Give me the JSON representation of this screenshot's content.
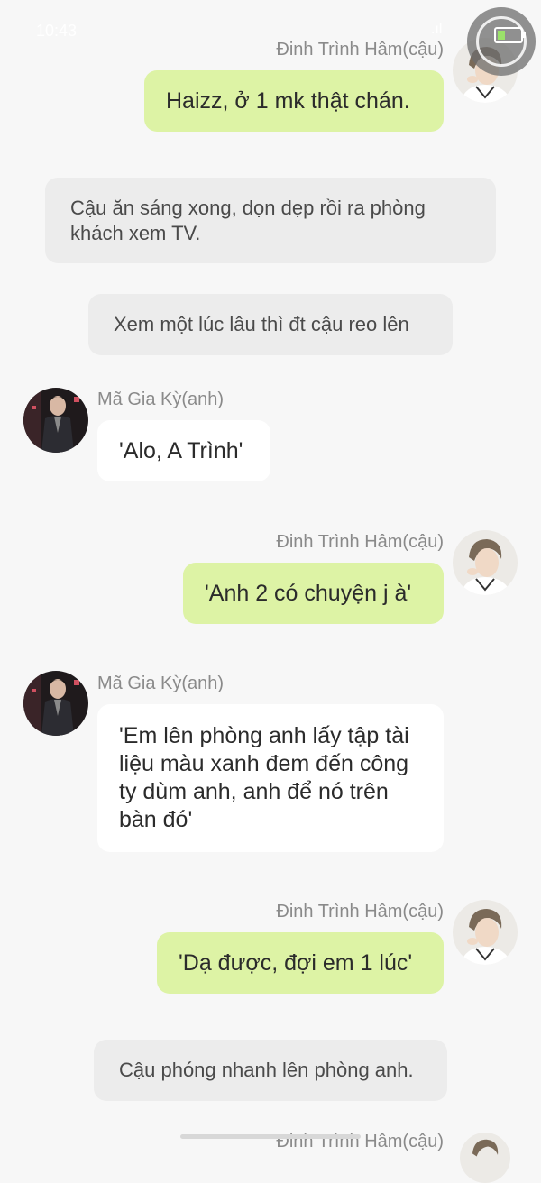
{
  "status_bar": {
    "time": "10:43",
    "signal": ".ıl"
  },
  "messages": [
    {
      "type": "right",
      "name": "Đinh Trình Hâm(cậu)",
      "text": "Haizz, ở 1 mk thật chán.",
      "avatar": "boy-avatar"
    },
    {
      "type": "narration",
      "text": "Cậu ăn sáng xong, dọn dẹp rồi ra phòng khách xem TV."
    },
    {
      "type": "narration",
      "text": "Xem một lúc lâu thì đt cậu reo lên"
    },
    {
      "type": "left",
      "name": "Mã Gia Kỳ(anh)",
      "text": "'Alo, A Trình'",
      "avatar": "man-avatar"
    },
    {
      "type": "right",
      "name": "Đinh Trình Hâm(cậu)",
      "text": "'Anh 2 có chuyện j à'",
      "avatar": "boy-avatar"
    },
    {
      "type": "left",
      "name": "Mã Gia Kỳ(anh)",
      "text": "'Em lên phòng anh lấy tập tài liệu màu xanh đem đến công ty dùm anh, anh để nó trên bàn đó'",
      "avatar": "man-avatar"
    },
    {
      "type": "right",
      "name": "Đinh Trình Hâm(cậu)",
      "text": "'Dạ được, đợi em 1 lúc'",
      "avatar": "boy-avatar"
    },
    {
      "type": "narration",
      "text": "Cậu phóng nhanh lên phòng anh."
    },
    {
      "type": "right",
      "name": "Đinh Trình Hâm(cậu)",
      "avatar": "boy-avatar"
    }
  ],
  "colors": {
    "green_bubble": "#ddf3a5",
    "white_bubble": "#ffffff",
    "narration_bg": "#ececec",
    "background": "#f7f7f7"
  }
}
